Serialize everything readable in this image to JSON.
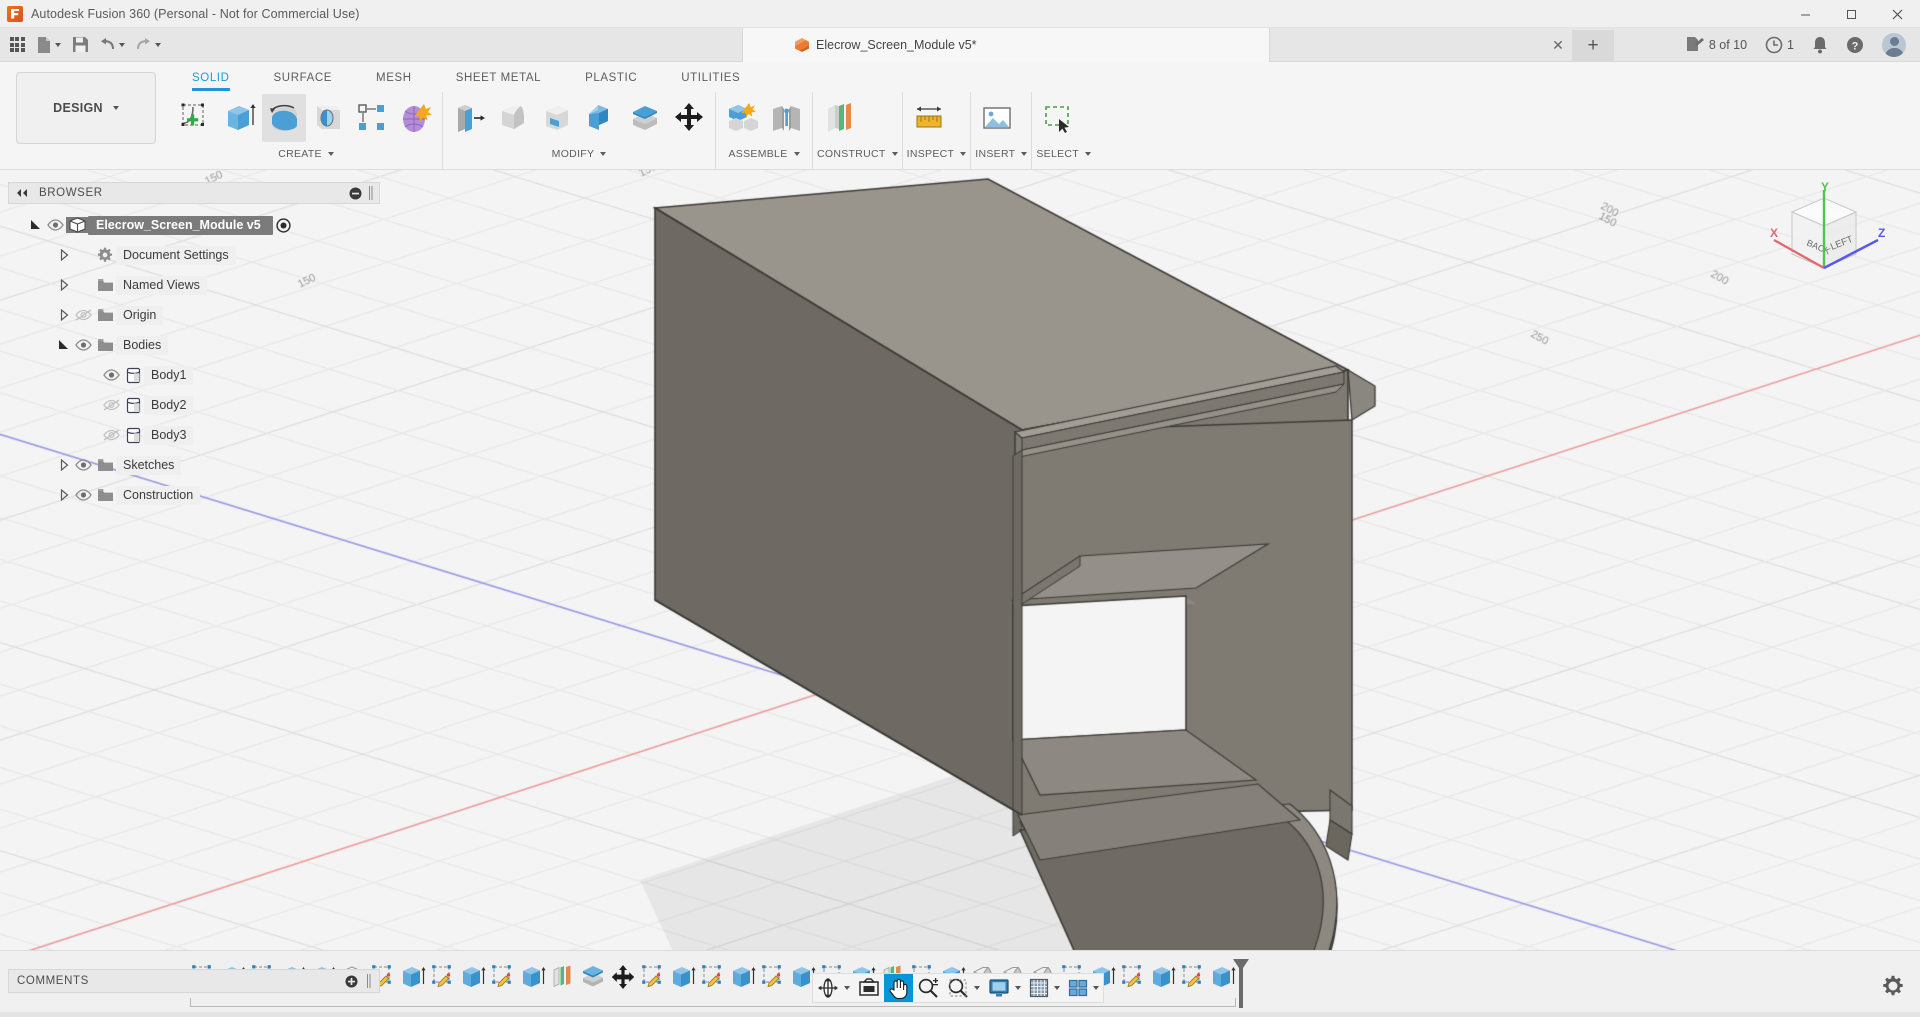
{
  "window": {
    "title": "Autodesk Fusion 360 (Personal - Not for Commercial Use)",
    "app_icon": "fusion-logo-icon",
    "minimize_label": "Minimize",
    "maximize_label": "Maximize",
    "close_label": "Close"
  },
  "quick_access": {
    "items": [
      {
        "name": "app-grid",
        "icon": "grid-icon"
      },
      {
        "name": "new-file",
        "icon": "file-icon",
        "has_caret": true
      },
      {
        "name": "save",
        "icon": "floppy-disk-icon"
      },
      {
        "name": "undo",
        "icon": "undo-arrow-icon",
        "has_caret": true
      },
      {
        "name": "redo",
        "icon": "redo-arrow-icon",
        "has_caret": true
      }
    ]
  },
  "document_tab": {
    "label": "Elecrow_Screen_Module v5*",
    "icon": "orange-cube-icon",
    "close_label": "✕",
    "new_tab_label": "+"
  },
  "account_bar": {
    "jobs_label": "8 of 10",
    "jobs_icon": "job-status-icon",
    "history_count": "1",
    "history_icon": "clock-icon",
    "notifications_icon": "bell-icon",
    "help_icon": "question-circle-icon",
    "avatar_icon": "user-avatar"
  },
  "workspace": {
    "label": "DESIGN",
    "caret": "▾"
  },
  "ribbon": {
    "tabs": [
      {
        "label": "SOLID",
        "active": true
      },
      {
        "label": "SURFACE",
        "active": false
      },
      {
        "label": "MESH",
        "active": false
      },
      {
        "label": "SHEET METAL",
        "active": false
      },
      {
        "label": "PLASTIC",
        "active": false
      },
      {
        "label": "UTILITIES",
        "active": false
      }
    ],
    "panels": [
      {
        "label": "CREATE",
        "caret": "▾",
        "tools": [
          {
            "name": "create-sketch-tool",
            "icon": "sketch-plus-icon",
            "selected": false
          },
          {
            "name": "extrude-tool",
            "icon": "extrude-icon",
            "selected": false
          },
          {
            "name": "revolve-tool",
            "icon": "revolve-icon",
            "selected": true
          },
          {
            "name": "sweep-tool",
            "icon": "sweep-icon",
            "selected": false
          },
          {
            "name": "pattern-tool",
            "icon": "rect-pattern-icon",
            "selected": false
          },
          {
            "name": "form-tool",
            "icon": "form-sculpt-icon",
            "selected": false
          }
        ]
      },
      {
        "label": "MODIFY",
        "caret": "▾",
        "tools": [
          {
            "name": "press-pull-tool",
            "icon": "press-pull-icon",
            "selected": false
          },
          {
            "name": "fillet-tool",
            "icon": "fillet-icon",
            "selected": false
          },
          {
            "name": "shell-tool",
            "icon": "shell-icon",
            "selected": false
          },
          {
            "name": "combine-tool",
            "icon": "combine-icon",
            "selected": false
          },
          {
            "name": "offset-face-tool",
            "icon": "offset-face-icon",
            "selected": false
          },
          {
            "name": "move-copy-tool",
            "icon": "move-arrows-icon",
            "selected": false
          }
        ]
      },
      {
        "label": "ASSEMBLE",
        "caret": "▾",
        "tools": [
          {
            "name": "new-component-tool",
            "icon": "new-component-icon",
            "selected": false
          },
          {
            "name": "joint-tool",
            "icon": "joint-icon",
            "selected": false
          }
        ]
      },
      {
        "label": "CONSTRUCT",
        "caret": "▾",
        "tools": [
          {
            "name": "offset-plane-tool",
            "icon": "offset-plane-icon",
            "selected": false
          }
        ]
      },
      {
        "label": "INSPECT",
        "caret": "▾",
        "tools": [
          {
            "name": "measure-tool",
            "icon": "ruler-measure-icon",
            "selected": false
          }
        ]
      },
      {
        "label": "INSERT",
        "caret": "▾",
        "tools": [
          {
            "name": "insert-image-tool",
            "icon": "picture-icon",
            "selected": false
          }
        ]
      },
      {
        "label": "SELECT",
        "caret": "▾",
        "tools": [
          {
            "name": "select-window-tool",
            "icon": "marquee-select-icon",
            "selected": false
          }
        ]
      }
    ]
  },
  "browser": {
    "title": "BROWSER",
    "collapse_icon": "double-left-chevron-icon",
    "minus_icon": "minus-circle-icon",
    "grip_icon": "panel-grip-icon",
    "nodes": [
      {
        "label": "Elecrow_Screen_Module v5",
        "indent": 0,
        "arrow": "expanded",
        "eye": "visible",
        "icon": "component-cube-icon",
        "selected": true,
        "radio": true
      },
      {
        "label": "Document Settings",
        "indent": 1,
        "arrow": "collapsed",
        "eye": "none",
        "icon": "gear-icon",
        "selected": false,
        "radio": false
      },
      {
        "label": "Named Views",
        "indent": 1,
        "arrow": "collapsed",
        "eye": "none",
        "icon": "folder-icon",
        "selected": false,
        "radio": false
      },
      {
        "label": "Origin",
        "indent": 1,
        "arrow": "collapsed",
        "eye": "hidden",
        "icon": "folder-icon",
        "selected": false,
        "radio": false
      },
      {
        "label": "Bodies",
        "indent": 1,
        "arrow": "expanded",
        "eye": "visible",
        "icon": "folder-icon",
        "selected": false,
        "radio": false
      },
      {
        "label": "Body1",
        "indent": 2,
        "arrow": "none",
        "eye": "visible",
        "icon": "body-icon",
        "selected": false,
        "radio": false
      },
      {
        "label": "Body2",
        "indent": 2,
        "arrow": "none",
        "eye": "hidden",
        "icon": "body-icon",
        "selected": false,
        "radio": false
      },
      {
        "label": "Body3",
        "indent": 2,
        "arrow": "none",
        "eye": "hidden",
        "icon": "body-icon",
        "selected": false,
        "radio": false
      },
      {
        "label": "Sketches",
        "indent": 1,
        "arrow": "collapsed",
        "eye": "visible",
        "icon": "folder-icon",
        "selected": false,
        "radio": false
      },
      {
        "label": "Construction",
        "indent": 1,
        "arrow": "collapsed",
        "eye": "visible",
        "icon": "folder-icon",
        "selected": false,
        "radio": false
      }
    ]
  },
  "comments": {
    "title": "COMMENTS",
    "add_icon": "plus-circle-icon",
    "grip_icon": "panel-grip-icon"
  },
  "navbar": {
    "items": [
      {
        "name": "orbit-button",
        "icon": "orbit-icon",
        "caret": true,
        "active": false
      },
      {
        "name": "look-at-button",
        "icon": "look-at-icon",
        "caret": false,
        "active": false
      },
      {
        "name": "pan-button",
        "icon": "hand-pan-icon",
        "caret": false,
        "active": true
      },
      {
        "name": "zoom-button",
        "icon": "magnifier-plusminus-icon",
        "caret": false,
        "active": false
      },
      {
        "name": "zoom-window-button",
        "icon": "magnifier-window-icon",
        "caret": true,
        "active": false
      },
      {
        "name": "display-settings-button",
        "icon": "monitor-icon",
        "caret": true,
        "active": false
      },
      {
        "name": "grid-snaps-button",
        "icon": "grid-dense-icon",
        "caret": true,
        "active": false
      },
      {
        "name": "viewports-button",
        "icon": "viewports-icon",
        "caret": true,
        "active": false
      }
    ]
  },
  "viewcube": {
    "front_face": "BACK",
    "right_face": "LEFT",
    "axis_x": "X",
    "axis_y": "Y",
    "axis_z": "Z",
    "color_x": "#e4686b",
    "color_y": "#4fc44f",
    "color_z": "#5a5ae6"
  },
  "viewport": {
    "grid_labels": [
      "150",
      "150",
      "150",
      "150",
      "200",
      "200",
      "250"
    ],
    "model_color_top": "#9a958c",
    "model_color_side": "#716d66",
    "model_color_front": "#7d7970",
    "axis_red": "#e88b8b",
    "axis_blue": "#8080d8"
  },
  "timeline": {
    "playback": [
      {
        "name": "go-to-beginning-button",
        "icon": "skip-start-icon"
      },
      {
        "name": "step-back-button",
        "icon": "step-back-icon"
      },
      {
        "name": "play-button",
        "icon": "play-icon"
      },
      {
        "name": "step-forward-button",
        "icon": "step-forward-icon"
      },
      {
        "name": "go-to-end-button",
        "icon": "skip-end-icon"
      }
    ],
    "features": [
      "sketch",
      "extrude",
      "sketch",
      "extrude",
      "extrude",
      "shell",
      "sketch",
      "extrude",
      "sketch",
      "extrude",
      "sketch",
      "extrude",
      "plane",
      "offset-face",
      "move",
      "sketch",
      "extrude",
      "sketch",
      "extrude",
      "sketch",
      "extrude",
      "sketch",
      "extrude",
      "plane",
      "sketch",
      "extrude",
      "fillet",
      "fillet",
      "fillet",
      "sketch",
      "extrude",
      "sketch",
      "extrude",
      "sketch",
      "extrude"
    ],
    "settings_icon": "gear-icon"
  }
}
